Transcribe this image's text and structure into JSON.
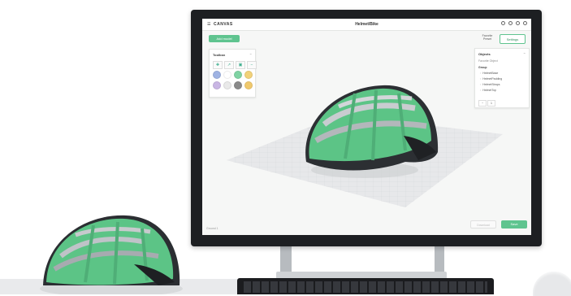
{
  "app": {
    "brand": "CANVAS",
    "menu_icon": "hamburger-icon",
    "document_title": "Helmet/Bike",
    "header_tools": [
      "help-icon",
      "share-icon",
      "info-icon",
      "user-icon"
    ]
  },
  "actions": {
    "add_model": "Add model",
    "preset_line1": "Favorite",
    "preset_line2": "Preset",
    "settings": "Settings",
    "download": "Download",
    "save": "Save"
  },
  "toolbox": {
    "title": "Toolbox",
    "collapse": "−",
    "tools": [
      "✚",
      "↗",
      "▣",
      "−"
    ],
    "swatches": [
      "#9fb3e3",
      "#ffffff",
      "#7fd3a3",
      "#f2d27a",
      "#c9b6e4",
      "#e9e9e9",
      "#8a8a8a",
      "#f0c96d"
    ]
  },
  "objects": {
    "title": "Objects",
    "collapse": "−",
    "subtitle": "Favorite Object",
    "group": "Group",
    "items": [
      "HelmetBase",
      "HelmetPadding",
      "HelmetStraps",
      "HelmetTop"
    ],
    "stepper": [
      "−",
      "1"
    ]
  },
  "floor_label": "Ground 1",
  "colors": {
    "accent": "#5fc48f",
    "helmet_green": "#5cc486",
    "helmet_dark": "#2c2f33",
    "bezel": "#1d1f22"
  }
}
